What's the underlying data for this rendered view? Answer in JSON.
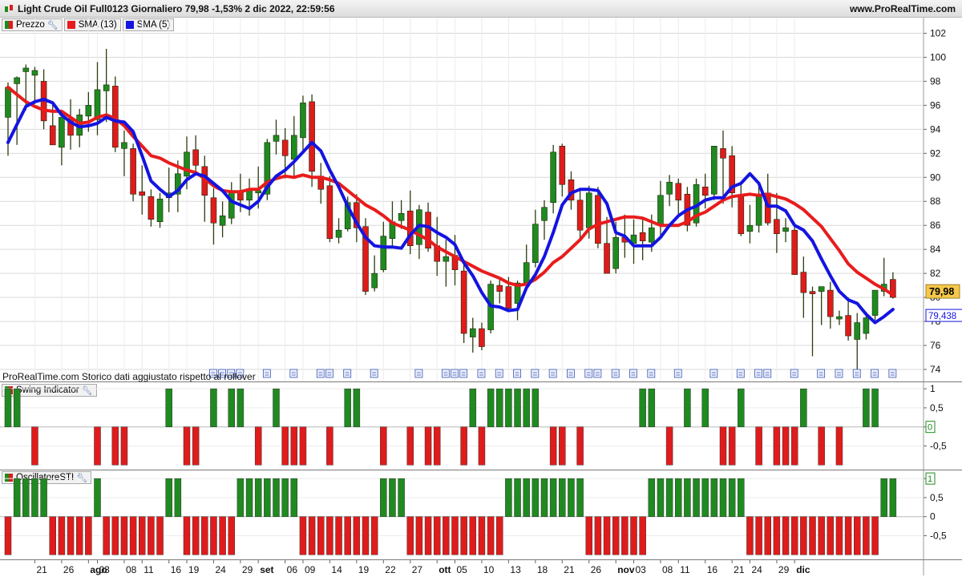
{
  "header": {
    "title": "Light Crude Oil Full0123 Giornaliero 79,98 -1,53% 2 dic 2022, 22:59:56",
    "site": "www.ProRealTime.com"
  },
  "price_panel": {
    "legend": [
      {
        "label": "Prezzo",
        "color": "#1f8a1f",
        "color2": "#e01b1b",
        "wrench": true
      },
      {
        "label": "SMA (13)",
        "color": "#e81c1c",
        "wrench": false
      },
      {
        "label": "SMA (5)",
        "color": "#1414e0",
        "wrench": false
      }
    ],
    "footer_note": "ProRealTime.com  Storico dati aggiustato rispetto al rollover",
    "last_price_label": "79,98",
    "sma5_label": "79,438"
  },
  "swing_panel": {
    "legend": "Swing Indicator",
    "last_value_label": "0"
  },
  "sti_panel": {
    "legend": "OscillatoreSTI",
    "last_value_label": "1"
  },
  "colors": {
    "up": "#1f8a1f",
    "down": "#e01b1b",
    "sma13": "#e81c1c",
    "sma5": "#1414e0",
    "grid": "#d9d9d9"
  },
  "chart_data": [
    {
      "type": "candlestick",
      "title": "Light Crude Oil Full0123 Giornaliero",
      "y_ticks": [
        74,
        76,
        78,
        80,
        82,
        84,
        86,
        88,
        90,
        92,
        94,
        96,
        98,
        100,
        102
      ],
      "y_tick_labels": [
        "74",
        "76",
        "78",
        "80",
        "82",
        "84",
        "86",
        "88",
        "90",
        "92",
        "94",
        "96",
        "98",
        "100",
        "102"
      ],
      "ylim": [
        73,
        103.3
      ],
      "x_tick_labels": [
        "21",
        "26",
        "ago",
        "03",
        "08",
        "11",
        "16",
        "19",
        "24",
        "29",
        "set",
        "06",
        "09",
        "14",
        "19",
        "22",
        "27",
        "ott",
        "05",
        "10",
        "13",
        "18",
        "21",
        "26",
        "nov",
        "03",
        "08",
        "11",
        "16",
        "21",
        "24",
        "29",
        "dic"
      ],
      "x_tick_bold": [
        "ago",
        "set",
        "ott",
        "nov",
        "dic"
      ],
      "x_tick_index": [
        3,
        6,
        9,
        10,
        13,
        15,
        18,
        20,
        23,
        26,
        28,
        31,
        33,
        36,
        39,
        42,
        45,
        48,
        50,
        53,
        56,
        59,
        62,
        65,
        68,
        70,
        73,
        75,
        78,
        81,
        83,
        86,
        88
      ],
      "ohlc": [
        [
          95.0,
          97.9,
          91.8,
          97.5
        ],
        [
          97.8,
          98.4,
          92.7,
          98.3
        ],
        [
          98.8,
          99.4,
          95.6,
          99.1
        ],
        [
          98.5,
          99.2,
          96.1,
          98.9
        ],
        [
          98.0,
          99.0,
          94.0,
          94.7
        ],
        [
          94.3,
          96.2,
          93.0,
          92.7
        ],
        [
          92.5,
          95.0,
          91.0,
          95.0
        ],
        [
          94.9,
          96.5,
          92.3,
          93.5
        ],
        [
          93.5,
          95.7,
          92.5,
          95.2
        ],
        [
          95.1,
          97.1,
          93.8,
          96.0
        ],
        [
          94.8,
          99.6,
          93.5,
          97.3
        ],
        [
          97.2,
          100.7,
          94.6,
          97.7
        ],
        [
          97.6,
          98.4,
          92.1,
          92.5
        ],
        [
          92.4,
          93.9,
          90.1,
          92.9
        ],
        [
          92.4,
          92.8,
          88.0,
          88.6
        ],
        [
          88.8,
          91.0,
          86.9,
          88.5
        ],
        [
          88.4,
          89.0,
          85.9,
          86.5
        ],
        [
          86.3,
          88.7,
          85.8,
          88.2
        ],
        [
          88.3,
          90.8,
          87.1,
          88.7
        ],
        [
          88.6,
          91.4,
          87.1,
          90.3
        ],
        [
          90.1,
          93.4,
          89.0,
          92.1
        ],
        [
          92.3,
          93.5,
          90.5,
          91.0
        ],
        [
          90.9,
          91.8,
          86.3,
          88.5
        ],
        [
          88.3,
          89.1,
          84.4,
          86.2
        ],
        [
          86.0,
          88.0,
          85.0,
          86.8
        ],
        [
          86.6,
          89.6,
          86.1,
          88.8
        ],
        [
          88.9,
          90.3,
          87.1,
          88.1
        ],
        [
          88.1,
          89.9,
          86.8,
          89.0
        ],
        [
          88.7,
          90.9,
          87.4,
          88.9
        ],
        [
          88.6,
          93.2,
          88.1,
          92.9
        ],
        [
          93.0,
          94.8,
          91.9,
          93.5
        ],
        [
          93.1,
          94.1,
          89.9,
          91.8
        ],
        [
          91.5,
          95.1,
          90.1,
          93.5
        ],
        [
          93.3,
          96.8,
          92.0,
          96.2
        ],
        [
          96.3,
          96.9,
          89.2,
          90.5
        ],
        [
          90.1,
          91.2,
          87.8,
          89.0
        ],
        [
          89.3,
          90.1,
          84.6,
          84.9
        ],
        [
          85.0,
          86.6,
          84.5,
          85.6
        ],
        [
          85.7,
          88.4,
          85.5,
          87.9
        ],
        [
          87.9,
          88.6,
          84.6,
          85.8
        ],
        [
          85.9,
          86.6,
          80.2,
          80.5
        ],
        [
          80.8,
          83.5,
          80.5,
          82.0
        ],
        [
          82.3,
          86.3,
          82.1,
          85.1
        ],
        [
          84.9,
          88.0,
          84.2,
          86.3
        ],
        [
          86.4,
          88.1,
          85.7,
          87.0
        ],
        [
          87.2,
          88.9,
          83.6,
          84.3
        ],
        [
          84.4,
          87.7,
          83.2,
          87.3
        ],
        [
          87.1,
          87.9,
          83.8,
          84.1
        ],
        [
          84.3,
          86.7,
          81.8,
          83.0
        ],
        [
          83.0,
          84.8,
          80.9,
          83.4
        ],
        [
          83.5,
          85.2,
          81.0,
          82.3
        ],
        [
          82.2,
          82.9,
          76.2,
          77.0
        ],
        [
          76.7,
          78.3,
          75.4,
          77.4
        ],
        [
          77.4,
          77.9,
          75.6,
          75.9
        ],
        [
          77.3,
          81.4,
          77.0,
          81.1
        ],
        [
          81.0,
          81.5,
          79.5,
          80.5
        ],
        [
          80.9,
          81.7,
          79.0,
          79.1
        ],
        [
          79.5,
          81.4,
          78.1,
          81.2
        ],
        [
          81.2,
          84.4,
          80.9,
          82.9
        ],
        [
          82.9,
          87.3,
          82.5,
          86.1
        ],
        [
          86.4,
          88.1,
          84.8,
          87.5
        ],
        [
          87.9,
          92.7,
          87.0,
          92.1
        ],
        [
          92.6,
          92.8,
          88.4,
          89.4
        ],
        [
          89.8,
          90.5,
          87.3,
          88.1
        ],
        [
          88.1,
          89.0,
          84.9,
          85.6
        ],
        [
          85.8,
          89.3,
          84.9,
          88.7
        ],
        [
          88.5,
          89.2,
          84.1,
          84.5
        ],
        [
          84.5,
          86.7,
          82.3,
          82.0
        ],
        [
          82.4,
          86.3,
          82.0,
          85.0
        ],
        [
          85.0,
          86.9,
          83.3,
          84.6
        ],
        [
          84.5,
          86.5,
          82.8,
          85.2
        ],
        [
          85.4,
          86.7,
          83.1,
          84.7
        ],
        [
          84.6,
          86.9,
          83.8,
          85.8
        ],
        [
          86.0,
          89.7,
          85.1,
          88.5
        ],
        [
          88.6,
          90.2,
          87.6,
          89.6
        ],
        [
          89.5,
          89.9,
          86.7,
          88.1
        ],
        [
          88.6,
          89.2,
          85.5,
          86.0
        ],
        [
          86.2,
          89.9,
          85.9,
          89.4
        ],
        [
          89.2,
          90.3,
          87.4,
          88.5
        ],
        [
          88.6,
          92.4,
          88.1,
          92.6
        ],
        [
          92.4,
          93.9,
          87.8,
          91.6
        ],
        [
          91.8,
          92.6,
          87.5,
          88.7
        ],
        [
          88.4,
          89.6,
          85.1,
          85.3
        ],
        [
          85.5,
          87.7,
          84.5,
          86.0
        ],
        [
          86.0,
          89.6,
          85.4,
          88.6
        ],
        [
          88.7,
          90.3,
          86.0,
          86.2
        ],
        [
          86.5,
          88.7,
          83.7,
          85.3
        ],
        [
          85.5,
          86.6,
          84.6,
          85.8
        ],
        [
          85.6,
          86.0,
          82.0,
          81.9
        ],
        [
          82.1,
          83.4,
          78.3,
          80.4
        ],
        [
          80.5,
          80.9,
          75.1,
          80.3
        ],
        [
          80.5,
          80.9,
          77.7,
          80.9
        ],
        [
          80.6,
          81.3,
          77.4,
          78.4
        ],
        [
          78.2,
          78.9,
          77.7,
          78.4
        ],
        [
          78.5,
          80.0,
          76.4,
          76.8
        ],
        [
          76.5,
          78.7,
          73.6,
          77.9
        ],
        [
          77.0,
          78.8,
          76.5,
          78.3
        ],
        [
          78.5,
          80.6,
          78.1,
          80.6
        ],
        [
          80.5,
          83.3,
          80.1,
          81.1
        ],
        [
          81.5,
          82.1,
          79.9,
          80.0
        ]
      ],
      "series": [
        {
          "name": "SMA (13)",
          "color": "#e81c1c",
          "values": [
            97.5,
            96.9,
            96.3,
            95.9,
            95.6,
            95.5,
            95.5,
            95.0,
            94.5,
            94.6,
            95.0,
            95.2,
            94.9,
            94.3,
            93.4,
            92.6,
            91.8,
            91.6,
            91.2,
            90.9,
            90.6,
            90.4,
            89.9,
            89.3,
            88.9,
            88.8,
            88.8,
            89.0,
            89.0,
            89.6,
            89.9,
            90.1,
            90.0,
            90.2,
            90.0,
            90.0,
            89.8,
            89.5,
            88.9,
            88.3,
            87.7,
            87.3,
            86.8,
            86.2,
            85.9,
            85.6,
            85.2,
            84.8,
            84.2,
            83.8,
            83.4,
            83.0,
            82.6,
            82.2,
            81.9,
            81.6,
            81.2,
            81.0,
            81.1,
            81.5,
            82.1,
            82.9,
            83.4,
            84.1,
            84.8,
            85.7,
            86.1,
            86.3,
            86.5,
            86.7,
            86.7,
            86.6,
            86.3,
            86.0,
            86.0,
            86.0,
            86.3,
            86.8,
            87.1,
            87.6,
            88.1,
            88.4,
            88.5,
            88.6,
            88.5,
            88.6,
            88.4,
            88.2,
            87.8,
            87.3,
            86.6,
            85.9,
            84.9,
            83.9,
            82.8,
            82.1,
            81.6,
            81.1,
            80.7,
            80.2
          ]
        },
        {
          "name": "SMA (5)",
          "color": "#1414e0",
          "values": [
            92.9,
            94.4,
            95.9,
            96.3,
            96.5,
            96.2,
            95.2,
            94.6,
            94.2,
            94.3,
            94.5,
            95.0,
            94.7,
            94.6,
            93.8,
            91.8,
            89.7,
            89.0,
            88.4,
            88.9,
            89.8,
            90.3,
            90.1,
            89.5,
            88.9,
            88.0,
            87.7,
            87.4,
            88.0,
            89.2,
            90.1,
            90.6,
            91.3,
            92.1,
            92.9,
            92.2,
            90.6,
            89.2,
            87.6,
            86.2,
            85.0,
            84.3,
            84.2,
            84.2,
            84.1,
            85.2,
            86.0,
            85.9,
            85.4,
            85.0,
            84.4,
            82.9,
            81.8,
            80.4,
            79.3,
            79.2,
            78.9,
            79.0,
            80.8,
            81.9,
            83.4,
            85.4,
            87.7,
            88.7,
            89.0,
            89.0,
            88.9,
            87.8,
            85.4,
            85.1,
            84.3,
            84.3,
            84.3,
            85.0,
            86.0,
            86.8,
            87.3,
            87.6,
            88.1,
            88.3,
            88.3,
            89.2,
            89.5,
            90.3,
            89.5,
            87.6,
            87.6,
            87.2,
            86.0,
            85.6,
            84.7,
            83.2,
            81.8,
            80.5,
            79.8,
            79.5,
            78.6,
            77.9,
            78.4,
            79.0
          ]
        }
      ]
    },
    {
      "type": "bar",
      "title": "Swing Indicator",
      "y_ticks": [
        -0.5,
        0,
        0.5,
        1
      ],
      "y_tick_labels": [
        "-0,5",
        "0",
        "0,5",
        "1"
      ],
      "ylim": [
        -1.1,
        1.15
      ],
      "values": [
        1,
        1,
        0,
        -1,
        0,
        0,
        0,
        0,
        0,
        0,
        -1,
        0,
        -1,
        -1,
        0,
        0,
        0,
        0,
        1,
        0,
        -1,
        -1,
        0,
        1,
        0,
        1,
        1,
        0,
        -1,
        0,
        1,
        -1,
        -1,
        -1,
        0,
        0,
        -1,
        0,
        1,
        1,
        0,
        0,
        -1,
        0,
        0,
        -1,
        0,
        -1,
        -1,
        0,
        0,
        -1,
        1,
        -1,
        1,
        1,
        1,
        1,
        1,
        1,
        0,
        -1,
        -1,
        0,
        -1,
        0,
        0,
        0,
        0,
        0,
        0,
        1,
        1,
        0,
        -1,
        0,
        1,
        0,
        1,
        0,
        -1,
        -1,
        1,
        0,
        -1,
        0,
        -1,
        -1,
        -1,
        1,
        0,
        -1,
        0,
        -1,
        0,
        0,
        1,
        1,
        0,
        0
      ]
    },
    {
      "type": "bar",
      "title": "OscillatoreSTI",
      "y_ticks": [
        -0.5,
        0,
        0.5,
        1
      ],
      "y_tick_labels": [
        "-0,5",
        "0",
        "0,5",
        "1"
      ],
      "ylim": [
        -1.1,
        1.15
      ],
      "values": [
        -1,
        1,
        1,
        1,
        1,
        -1,
        -1,
        -1,
        -1,
        -1,
        1,
        -1,
        -1,
        -1,
        -1,
        -1,
        -1,
        -1,
        1,
        1,
        -1,
        -1,
        -1,
        -1,
        -1,
        -1,
        1,
        1,
        1,
        1,
        1,
        1,
        1,
        -1,
        -1,
        -1,
        -1,
        -1,
        -1,
        -1,
        -1,
        -1,
        1,
        1,
        1,
        -1,
        -1,
        -1,
        -1,
        -1,
        -1,
        -1,
        -1,
        -1,
        -1,
        -1,
        1,
        1,
        1,
        1,
        1,
        1,
        1,
        1,
        1,
        -1,
        -1,
        -1,
        -1,
        -1,
        -1,
        -1,
        1,
        1,
        1,
        1,
        1,
        1,
        1,
        1,
        1,
        1,
        1,
        -1,
        -1,
        -1,
        -1,
        -1,
        -1,
        -1,
        -1,
        -1,
        -1,
        -1,
        -1,
        -1,
        -1,
        -1,
        1,
        1
      ]
    }
  ]
}
